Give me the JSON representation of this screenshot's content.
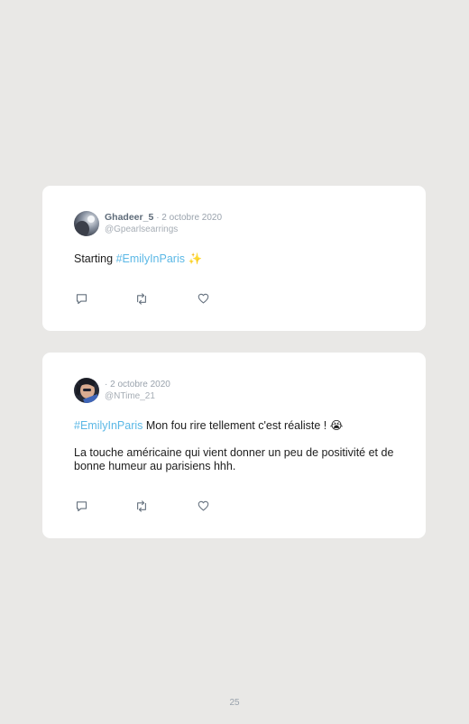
{
  "tweets": [
    {
      "username": "Ghadeer_5",
      "date": "· 2 octobre 2020",
      "handle": "@Gpearlsearrings",
      "hashtag": "#EmilyInParis",
      "text_before": "Starting ",
      "text_after": " ✨"
    },
    {
      "username": "",
      "date": "· 2 octobre 2020",
      "handle": "@NTime_21",
      "hashtag": "#EmilyInParis",
      "text_before": "",
      "text_after": " Mon fou rire tellement c'est réaliste ! 😭",
      "paragraph2": "La touche américaine qui vient donner un peu de positivité et de bonne humeur au parisiens hhh."
    }
  ],
  "page_number": "25",
  "colors": {
    "background": "#e9e8e6",
    "card": "#ffffff",
    "hashtag": "#5bb8e6",
    "icon": "#65717e"
  },
  "icons": [
    "reply-icon",
    "retweet-icon",
    "like-icon"
  ]
}
